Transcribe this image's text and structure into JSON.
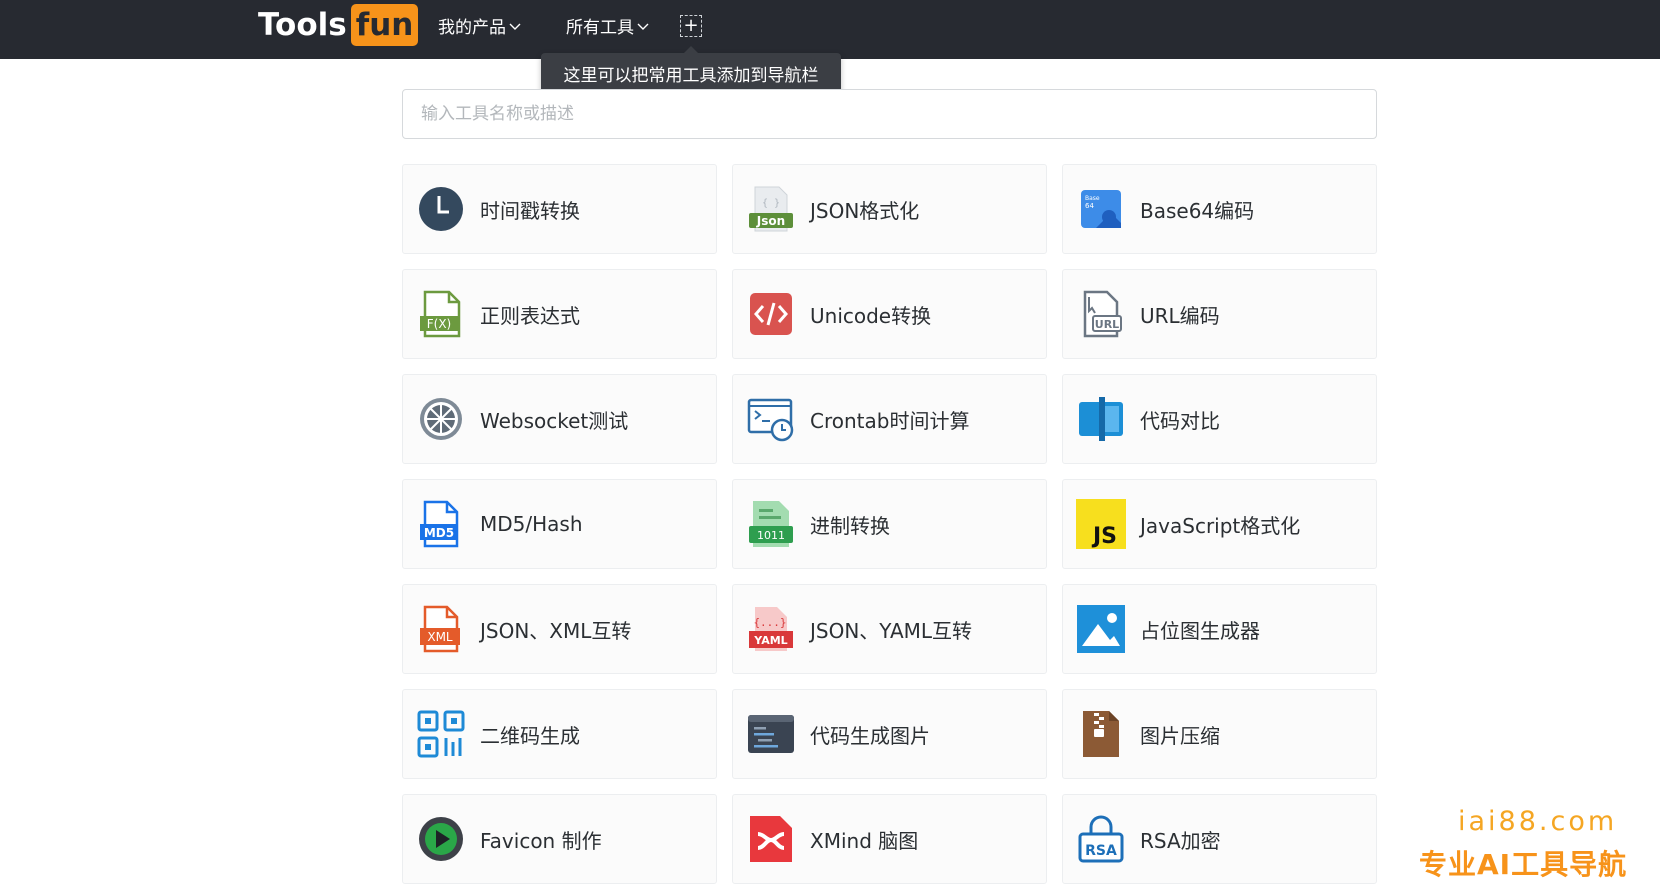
{
  "brand": {
    "part1": "Tools",
    "part2": "fun"
  },
  "nav": {
    "products": "我的产品",
    "all_tools": "所有工具",
    "add": "+"
  },
  "tooltip": "这里可以把常用工具添加到导航栏",
  "search": {
    "placeholder": "输入工具名称或描述",
    "value": ""
  },
  "tools": [
    {
      "label": "时间戳转换",
      "icon": "clock-icon"
    },
    {
      "label": "JSON格式化",
      "icon": "json-file-icon"
    },
    {
      "label": "Base64编码",
      "icon": "base64-icon"
    },
    {
      "label": "正则表达式",
      "icon": "function-file-icon"
    },
    {
      "label": "Unicode转换",
      "icon": "code-brackets-icon"
    },
    {
      "label": "URL编码",
      "icon": "url-file-icon"
    },
    {
      "label": "Websocket测试",
      "icon": "websocket-icon"
    },
    {
      "label": "Crontab时间计算",
      "icon": "terminal-timer-icon"
    },
    {
      "label": "代码对比",
      "icon": "split-compare-icon"
    },
    {
      "label": "MD5/Hash",
      "icon": "md5-file-icon"
    },
    {
      "label": "进制转换",
      "icon": "binary-file-icon"
    },
    {
      "label": "JavaScript格式化",
      "icon": "javascript-icon"
    },
    {
      "label": "JSON、XML互转",
      "icon": "xml-file-icon"
    },
    {
      "label": "JSON、YAML互转",
      "icon": "yaml-file-icon"
    },
    {
      "label": "占位图生成器",
      "icon": "image-placeholder-icon"
    },
    {
      "label": "二维码生成",
      "icon": "qrcode-icon"
    },
    {
      "label": "代码生成图片",
      "icon": "code-image-icon"
    },
    {
      "label": "图片压缩",
      "icon": "zip-file-icon"
    },
    {
      "label": "Favicon 制作",
      "icon": "favicon-icon"
    },
    {
      "label": "XMind 脑图",
      "icon": "xmind-icon"
    },
    {
      "label": "RSA加密",
      "icon": "rsa-lock-icon"
    }
  ],
  "watermark": {
    "domain": "iai88.com",
    "slogan": "专业AI工具导航"
  },
  "colors": {
    "navbar": "#272a31",
    "brand_accent": "#f7931a",
    "watermark": "#f5a623"
  }
}
